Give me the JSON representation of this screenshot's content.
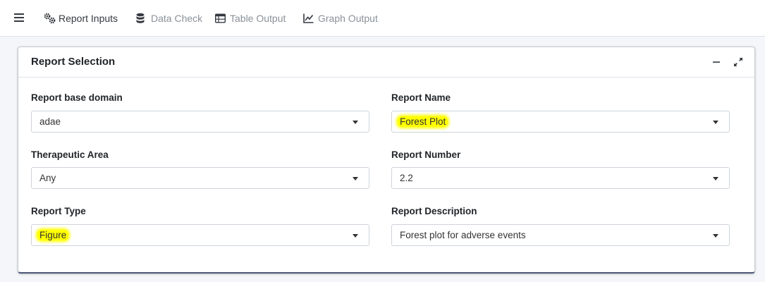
{
  "nav": {
    "items": [
      {
        "label": "Report Inputs",
        "icon": "cogs-icon",
        "active": true
      },
      {
        "label": "Data Check",
        "icon": "database-icon",
        "active": false
      },
      {
        "label": "Table Output",
        "icon": "table-icon",
        "active": false
      },
      {
        "label": "Graph Output",
        "icon": "line-chart-icon",
        "active": false
      }
    ]
  },
  "card": {
    "title": "Report Selection",
    "fields": {
      "report_base_domain": {
        "label": "Report base domain",
        "value": "adae"
      },
      "therapeutic_area": {
        "label": "Therapeutic Area",
        "value": "Any"
      },
      "report_type": {
        "label": "Report Type",
        "value": "Figure"
      },
      "report_name": {
        "label": "Report Name",
        "value": "Forest Plot"
      },
      "report_number": {
        "label": "Report Number",
        "value": "2.2"
      },
      "report_description": {
        "label": "Report Description",
        "value": "Forest plot for adverse events"
      }
    }
  },
  "colors": {
    "highlight": "#ffff00",
    "card_bottom_border": "#4b5779",
    "nav_inactive": "#8a9199"
  }
}
